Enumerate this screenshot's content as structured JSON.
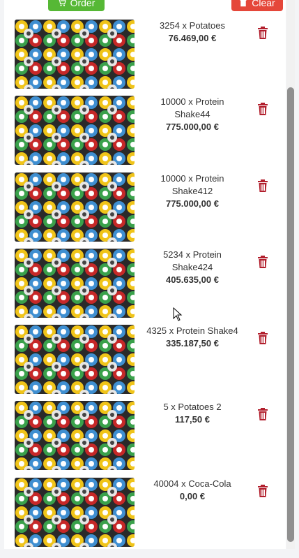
{
  "toolbar": {
    "order_label": "Order",
    "clear_label": "Clear"
  },
  "cart": {
    "items": [
      {
        "name": "3254 x Potatoes",
        "price": "76.469,00 €"
      },
      {
        "name": "10000 x Protein Shake44",
        "price": "775.000,00 €"
      },
      {
        "name": "10000 x Protein Shake412",
        "price": "775.000,00 €"
      },
      {
        "name": "5234 x Protein Shake424",
        "price": "405.635,00 €"
      },
      {
        "name": "4325 x Protein Shake4",
        "price": "335.187,50 €"
      },
      {
        "name": "5 x Potatoes 2",
        "price": "117,50 €"
      },
      {
        "name": "40004 x Coca-Cola",
        "price": "0,00 €"
      }
    ]
  },
  "colors": {
    "order": "#56b835",
    "clear": "#e5473a",
    "trash": "#b21f2d"
  },
  "icons": {
    "order": "cart-icon",
    "clear": "trash-icon",
    "remove": "trash-icon"
  }
}
